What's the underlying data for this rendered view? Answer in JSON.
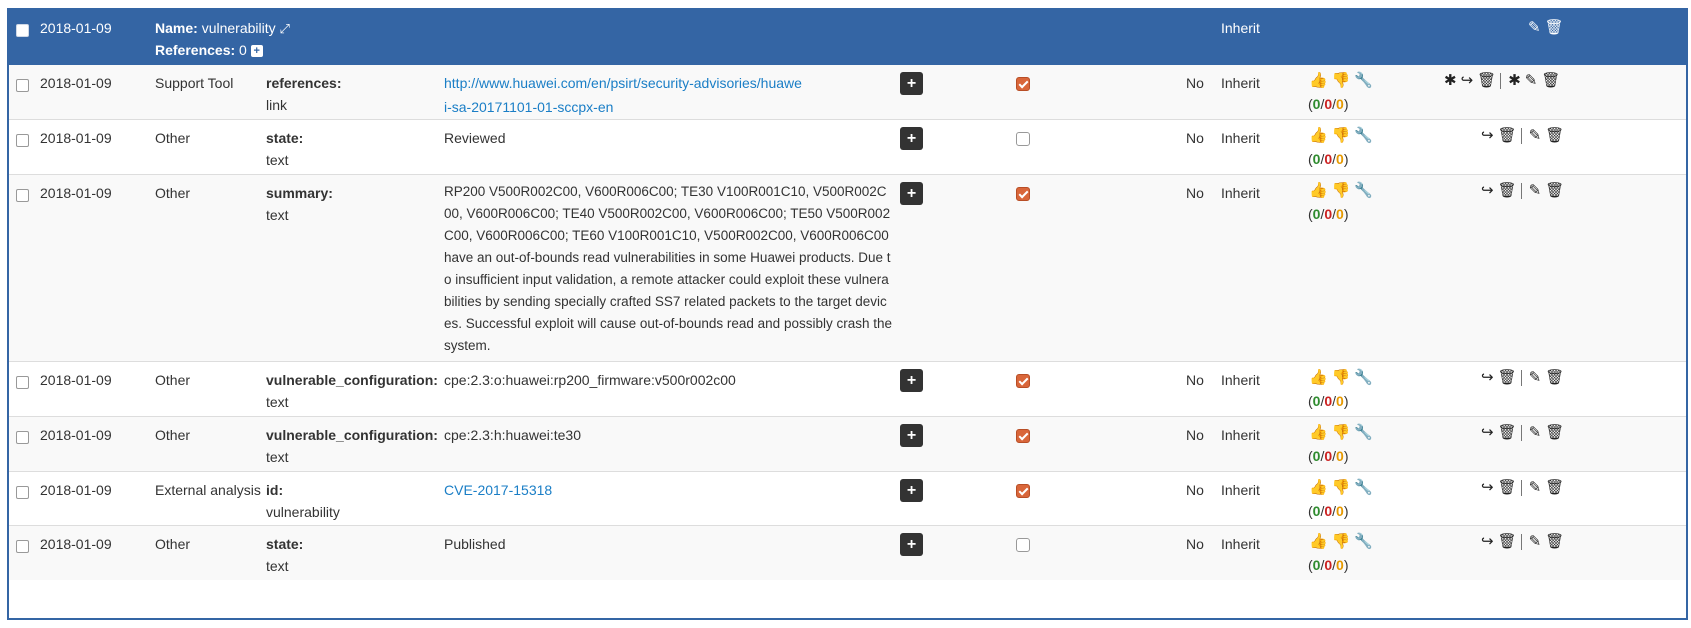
{
  "header": {
    "date": "2018-01-09",
    "name_label": "Name:",
    "name_value": "vulnerability",
    "references_label": "References:",
    "references_value": "0",
    "inherit": "Inherit"
  },
  "rows": [
    {
      "date": "2018-01-09",
      "source": "Support Tool",
      "key": "references:",
      "type": "link",
      "value": "http://www.huawei.com/en/psirt/security-advisories/huawei-sa-20171101-01-sccpx-en",
      "checked": true,
      "no": "No",
      "inherit": "Inherit",
      "votes": [
        "0",
        "0",
        "0"
      ]
    },
    {
      "date": "2018-01-09",
      "source": "Other",
      "key": "state:",
      "type": "text",
      "value": "Reviewed",
      "checked": false,
      "no": "No",
      "inherit": "Inherit",
      "votes": [
        "0",
        "0",
        "0"
      ]
    },
    {
      "date": "2018-01-09",
      "source": "Other",
      "key": "summary:",
      "type": "text",
      "value": "RP200 V500R002C00, V600R006C00; TE30 V100R001C10, V500R002C00, V600R006C00; TE40 V500R002C00, V600R006C00; TE50 V500R002C00, V600R006C00; TE60 V100R001C10, V500R002C00, V600R006C00 have an out-of-bounds read vulnerabilities in some Huawei products. Due to insufficient input validation, a remote attacker could exploit these vulnerabilities by sending specially crafted SS7 related packets to the target devices. Successful exploit will cause out-of-bounds read and possibly crash the system.",
      "checked": true,
      "no": "No",
      "inherit": "Inherit",
      "votes": [
        "0",
        "0",
        "0"
      ]
    },
    {
      "date": "2018-01-09",
      "source": "Other",
      "key": "vulnerable_configuration:",
      "type": "text",
      "value": "cpe:2.3:o:huawei:rp200_firmware:v500r002c00",
      "checked": true,
      "no": "No",
      "inherit": "Inherit",
      "votes": [
        "0",
        "0",
        "0"
      ]
    },
    {
      "date": "2018-01-09",
      "source": "Other",
      "key": "vulnerable_configuration:",
      "type": "text",
      "value": "cpe:2.3:h:huawei:te30",
      "checked": true,
      "no": "No",
      "inherit": "Inherit",
      "votes": [
        "0",
        "0",
        "0"
      ]
    },
    {
      "date": "2018-01-09",
      "source": "External analysis",
      "key": "id:",
      "type": "vulnerability",
      "value": "CVE-2017-15318",
      "checked": true,
      "no": "No",
      "inherit": "Inherit",
      "votes": [
        "0",
        "0",
        "0"
      ]
    },
    {
      "date": "2018-01-09",
      "source": "Other",
      "key": "state:",
      "type": "text",
      "value": "Published",
      "checked": false,
      "no": "No",
      "inherit": "Inherit",
      "votes": [
        "0",
        "0",
        "0"
      ]
    }
  ],
  "icons": {
    "header": [
      "edit-icon",
      "trash-icon"
    ],
    "row_actions": [
      "thumbs-up-icon",
      "thumbs-down-icon",
      "wrench-icon"
    ],
    "first_row_extra": [
      "asterisk-icon",
      "share-icon",
      "trash-icon",
      "asterisk-icon",
      "edit-icon",
      "trash-icon"
    ],
    "other_rows": [
      "share-icon",
      "trash-icon",
      "edit-icon",
      "trash-icon"
    ]
  },
  "colors": {
    "header_bg": "#3465a4",
    "checkbox_checked": "#d9663a",
    "vote_green": "#2e8b2e",
    "vote_red": "#cc2222",
    "vote_orange": "#e69900",
    "link": "#1a7ec6"
  }
}
